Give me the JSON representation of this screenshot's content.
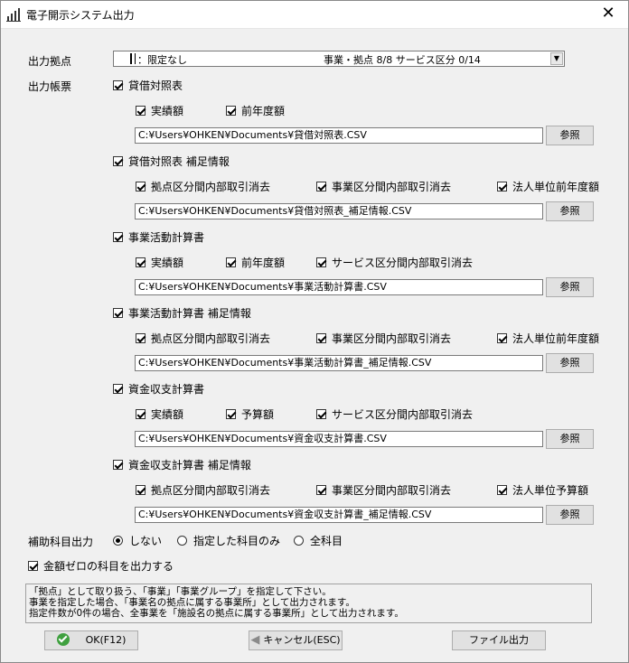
{
  "window": {
    "title": "電子開示システム出力",
    "close": "✕"
  },
  "fields": {
    "location_label": "出力拠点",
    "location_value_left": "：限定なし",
    "location_value_right": "事業・拠点 8/8 サービス区分 0/14",
    "forms_label": "出力帳票"
  },
  "sections": [
    {
      "title": "貸借対照表",
      "checked": true,
      "options": [
        {
          "label": "実績額",
          "checked": true
        },
        {
          "label": "前年度額",
          "checked": true
        }
      ],
      "path": "C:¥Users¥OHKEN¥Documents¥貸借対照表.CSV",
      "browse": "参照"
    },
    {
      "title": "貸借対照表 補足情報",
      "checked": true,
      "options": [
        {
          "label": "拠点区分間内部取引消去",
          "checked": true
        },
        {
          "label": "事業区分間内部取引消去",
          "checked": true
        },
        {
          "label": "法人単位前年度額",
          "checked": true
        }
      ],
      "path": "C:¥Users¥OHKEN¥Documents¥貸借対照表_補足情報.CSV",
      "browse": "参照"
    },
    {
      "title": "事業活動計算書",
      "checked": true,
      "options": [
        {
          "label": "実績額",
          "checked": true
        },
        {
          "label": "前年度額",
          "checked": true
        },
        {
          "label": "サービス区分間内部取引消去",
          "checked": true
        }
      ],
      "path": "C:¥Users¥OHKEN¥Documents¥事業活動計算書.CSV",
      "browse": "参照"
    },
    {
      "title": "事業活動計算書 補足情報",
      "checked": true,
      "options": [
        {
          "label": "拠点区分間内部取引消去",
          "checked": true
        },
        {
          "label": "事業区分間内部取引消去",
          "checked": true
        },
        {
          "label": "法人単位前年度額",
          "checked": true
        }
      ],
      "path": "C:¥Users¥OHKEN¥Documents¥事業活動計算書_補足情報.CSV",
      "browse": "参照"
    },
    {
      "title": "資金収支計算書",
      "checked": true,
      "options": [
        {
          "label": "実績額",
          "checked": true
        },
        {
          "label": "予算額",
          "checked": true
        },
        {
          "label": "サービス区分間内部取引消去",
          "checked": true
        }
      ],
      "path": "C:¥Users¥OHKEN¥Documents¥資金収支計算書.CSV",
      "browse": "参照"
    },
    {
      "title": "資金収支計算書 補足情報",
      "checked": true,
      "options": [
        {
          "label": "拠点区分間内部取引消去",
          "checked": true
        },
        {
          "label": "事業区分間内部取引消去",
          "checked": true
        },
        {
          "label": "法人単位予算額",
          "checked": true
        }
      ],
      "path": "C:¥Users¥OHKEN¥Documents¥資金収支計算書_補足情報.CSV",
      "browse": "参照"
    }
  ],
  "subject_output": {
    "label": "補助科目出力",
    "options": [
      {
        "label": "しない",
        "selected": true
      },
      {
        "label": "指定した科目のみ",
        "selected": false
      },
      {
        "label": "全科目",
        "selected": false
      }
    ]
  },
  "zero_amount": {
    "label": "金額ゼロの科目を出力する",
    "checked": true
  },
  "message": "「拠点」として取り扱う、「事業」「事業グループ」を指定して下さい。\n事業を指定した場合、「事業名の拠点に属する事業所」として出力されます。\n指定件数が0件の場合、全事業を「施設名の拠点に属する事業所」として出力されます。",
  "buttons": {
    "ok": "OK(F12)",
    "cancel": "キャンセル(ESC)",
    "export": "ファイル出力"
  }
}
